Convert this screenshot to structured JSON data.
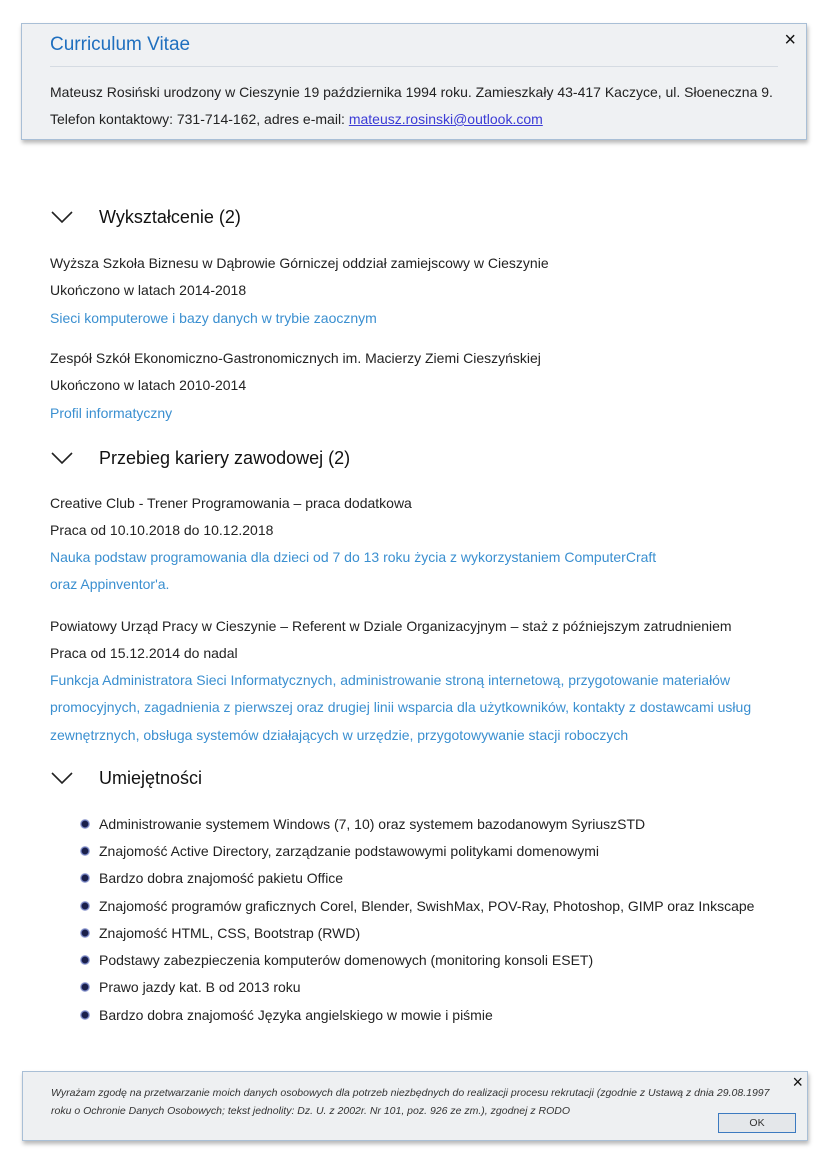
{
  "header": {
    "title": "Curriculum Vitae",
    "close_label": "×",
    "line1": "Mateusz Rosiński urodzony w Cieszynie 19 października 1994 roku. Zamieszkały  43-417 Kaczyce, ul. Słoeneczna 9.",
    "line2_prefix": "Telefon kontaktowy: 731-714-162, adres e-mail: ",
    "email": "mateusz.rosinski@outlook.com"
  },
  "education": {
    "title": "Wykształcenie (2)",
    "entries": [
      {
        "school": "Wyższa Szkoła Biznesu w Dąbrowie Górniczej oddział zamiejscowy w Cieszynie",
        "years": "Ukończono w latach 2014-2018",
        "detail": "Sieci komputerowe i bazy danych w trybie zaocznym"
      },
      {
        "school": "Zespół Szkół Ekonomiczno-Gastronomicznych im. Macierzy Ziemi Cieszyńskiej",
        "years": "Ukończono w latach 2010-2014",
        "detail": "Profil informatyczny"
      }
    ]
  },
  "career": {
    "title": "Przebieg kariery zawodowej (2)",
    "entries": [
      {
        "position": "Creative Club - Trener Programowania – praca dodatkowa",
        "period": "Praca od 10.10.2018 do 10.12.2018",
        "detail_lines": [
          "Nauka podstaw programowania dla dzieci od 7 do 13 roku życia z wykorzystaniem ComputerCraft",
          "oraz Appinventor'a."
        ]
      },
      {
        "position": "Powiatowy Urząd Pracy w Cieszynie – Referent w Dziale Organizacyjnym – staż z późniejszym zatrudnieniem",
        "period": "Praca od 15.12.2014 do nadal",
        "detail_lines": [
          "Funkcja Administratora Sieci Informatycznych, administrowanie stroną internetową, przygotowanie materiałów",
          "promocyjnych, zagadnienia z pierwszej oraz drugiej linii wsparcia dla użytkowników, kontakty z dostawcami usług",
          "zewnętrznych, obsługa systemów działających w urzędzie, przygotowywanie stacji roboczych"
        ]
      }
    ]
  },
  "skills": {
    "title": "Umiejętności",
    "items": [
      "Administrowanie systemem Windows (7, 10) oraz systemem bazodanowym SyriuszSTD",
      "Znajomość Active Directory, zarządzanie podstawowymi politykami domenowymi",
      "Bardzo dobra znajomość pakietu Office",
      "Znajomość programów graficznych Corel, Blender, SwishMax, POV-Ray, Photoshop, GIMP oraz Inkscape",
      "Znajomość HTML, CSS, Bootstrap (RWD)",
      "Podstawy zabezpieczenia komputerów domenowych (monitoring konsoli ESET)",
      "Prawo jazdy kat. B od 2013 roku",
      "Bardzo dobra znajomość Języka angielskiego w mowie i piśmie"
    ]
  },
  "consent": {
    "text": "Wyrażam zgodę na przetwarzanie moich danych osobowych dla potrzeb niezbędnych do realizacji procesu rekrutacji (zgodnie z Ustawą z dnia 29.08.1997 roku o Ochronie Danych Osobowych; tekst jednolity: Dz. U. z 2002r. Nr 101, poz. 926 ze zm.), zgodnej z RODO",
    "close_label": "×",
    "ok_label": "OK"
  },
  "colors": {
    "accent_title": "#1f6fbf",
    "link_blue": "#3a8fd0",
    "email_link": "#3b3bd6",
    "card_bg": "#eff1f3",
    "card_border": "#a9bfd6"
  },
  "icons": {
    "section_toggle": "chevron-down-icon",
    "skill_bullet": "bullet-icon",
    "close": "close-icon"
  }
}
